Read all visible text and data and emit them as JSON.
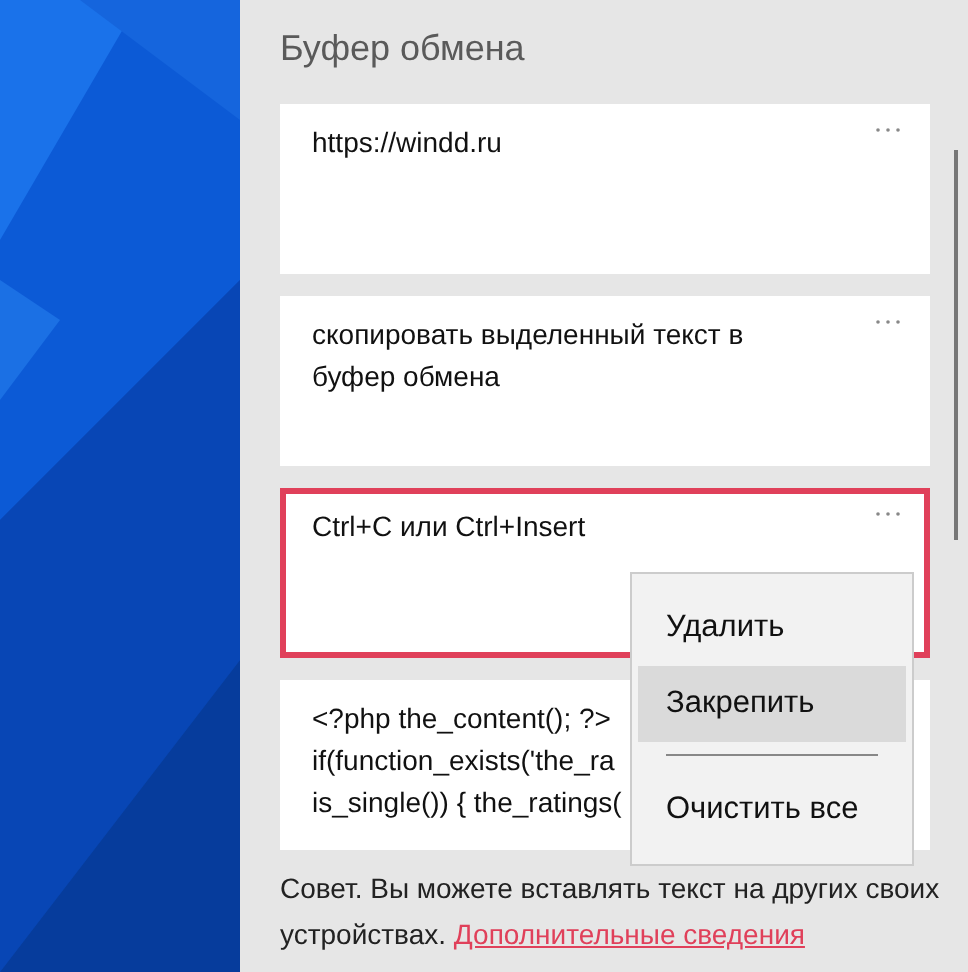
{
  "panel": {
    "title": "Буфер обмена"
  },
  "clips": [
    {
      "lines": [
        "https://windd.ru"
      ],
      "selected": false
    },
    {
      "lines": [
        "скопировать выделенный текст в буфер обмена"
      ],
      "selected": false
    },
    {
      "lines": [
        "Ctrl+C или Ctrl+Insert"
      ],
      "selected": true
    },
    {
      "lines": [
        "<?php the_content(); ?>",
        "if(function_exists('the_ra",
        "is_single()) { the_ratings("
      ],
      "selected": false
    }
  ],
  "context_menu": {
    "items": [
      {
        "label": "Удалить",
        "selected": false,
        "divider_after": false
      },
      {
        "label": "Закрепить",
        "selected": true,
        "divider_after": true
      },
      {
        "label": "Очистить все",
        "selected": false,
        "divider_after": false
      }
    ]
  },
  "tip": {
    "text": "Совет. Вы можете вставлять текст на других своих устройствах.",
    "link": "Дополнительные сведения"
  }
}
